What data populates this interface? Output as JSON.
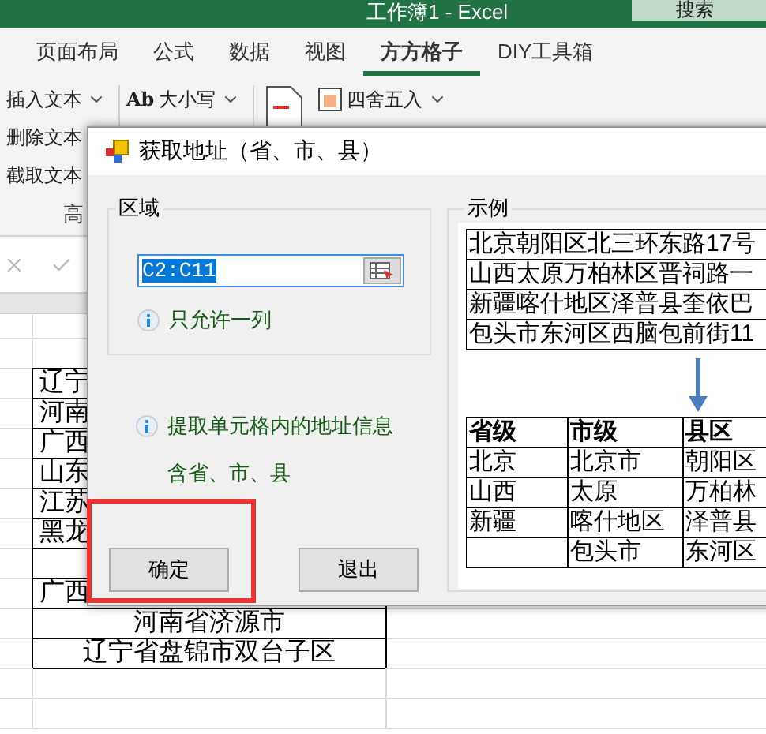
{
  "excel": {
    "title": "工作簿1 - Excel",
    "search": "搜索",
    "tabs": [
      {
        "label": "页面布局",
        "selected": false
      },
      {
        "label": "公式",
        "selected": false
      },
      {
        "label": "数据",
        "selected": false
      },
      {
        "label": "视图",
        "selected": false
      },
      {
        "label": "方方格子",
        "selected": true
      },
      {
        "label": "DIY工具箱",
        "selected": false
      }
    ],
    "ribbon": {
      "text_tools": [
        "插入文本",
        "删除文本",
        "截取文本"
      ],
      "group_label": "高",
      "case_icon": "Ab",
      "case_label": "大小写",
      "round_label": "四舍五入"
    },
    "sheet_rows": [
      "",
      "辽宁",
      "河南",
      "广西",
      "山东",
      "江苏",
      "黑龙",
      "",
      "广西",
      "河南省济源市",
      "辽宁省盘锦市双台子区",
      "",
      ""
    ]
  },
  "dialog": {
    "title": "获取地址（省、市、县）",
    "range_group": {
      "title": "区域",
      "value": "C2:C11",
      "value_selected": true,
      "hint": "只允许一列"
    },
    "info": "提取单元格内的地址信息",
    "info_detail": "含省、市、县",
    "buttons": [
      {
        "label": "确定",
        "highlighted": true
      },
      {
        "label": "退出",
        "highlighted": false
      }
    ],
    "example": {
      "title": "示例",
      "sources": [
        "北京朝阳区北三环东路17号",
        "山西太原万柏林区晋祠路一",
        "新疆喀什地区泽普县奎依巴",
        "包头市东河区西脑包前街11"
      ],
      "columns": [
        "省级",
        "市级",
        "县区"
      ],
      "rows": [
        [
          "北京",
          "北京市",
          "朝阳区"
        ],
        [
          "山西",
          "太原",
          "万柏林"
        ],
        [
          "新疆",
          "喀什地区",
          "泽普县"
        ],
        [
          "",
          "包头市",
          "东河区"
        ]
      ]
    }
  }
}
